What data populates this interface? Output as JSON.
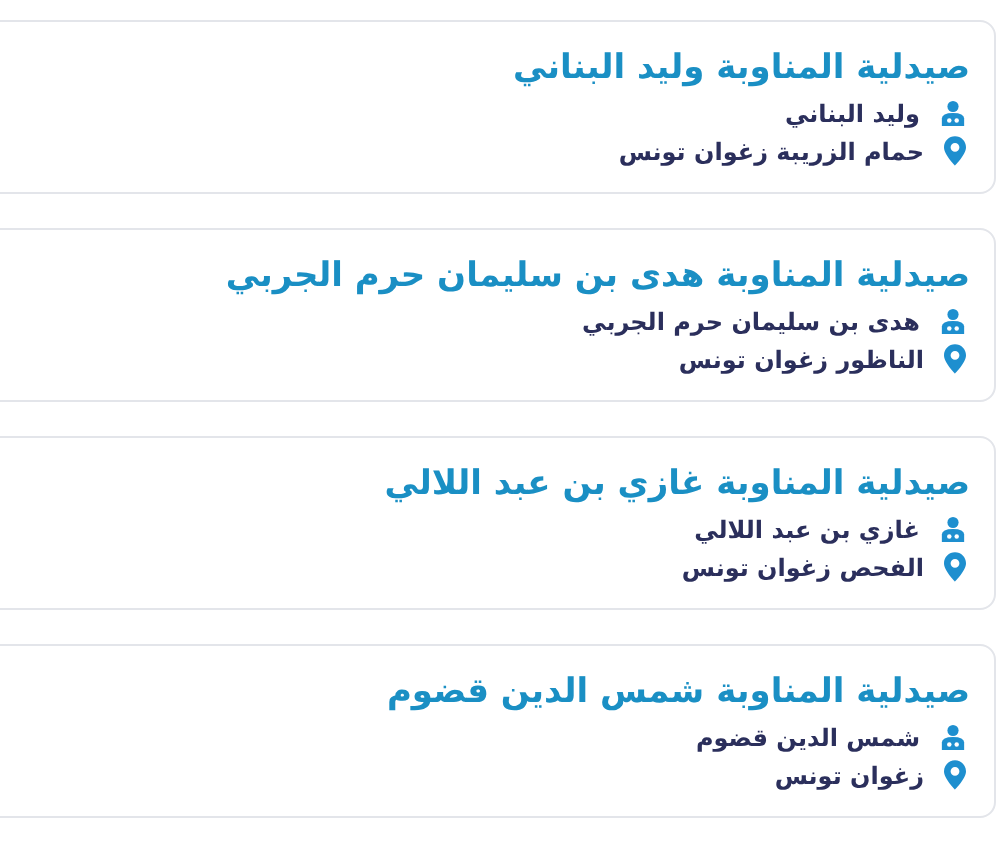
{
  "pharmacies": [
    {
      "title": "صيدلية المناوبة وليد البناني",
      "owner": "وليد البناني",
      "address": "حمام الزريبة زغوان تونس"
    },
    {
      "title": "صيدلية المناوبة هدى بن سليمان حرم الجربي",
      "owner": "هدى بن سليمان حرم الجربي",
      "address": "الناظور زغوان تونس"
    },
    {
      "title": "صيدلية المناوبة غازي بن عبد اللالي",
      "owner": "غازي بن عبد اللالي",
      "address": "الفحص زغوان تونس"
    },
    {
      "title": "صيدلية المناوبة شمس الدين قضوم",
      "owner": "شمس الدين قضوم",
      "address": "زغوان تونس"
    }
  ]
}
